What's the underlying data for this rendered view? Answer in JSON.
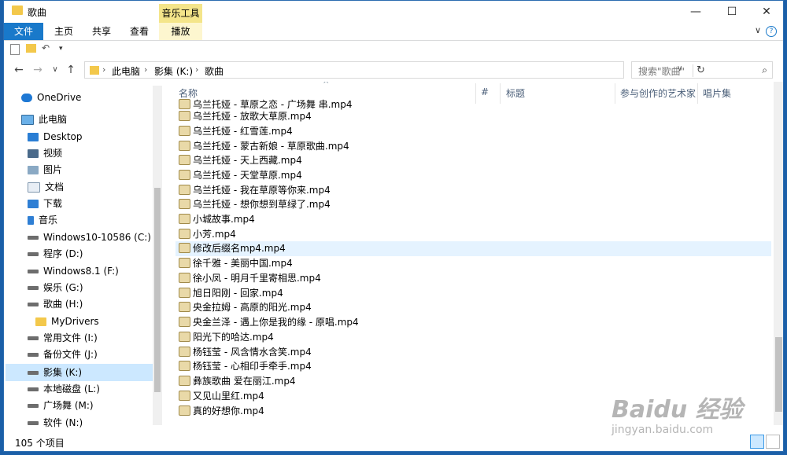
{
  "window": {
    "title": "歌曲",
    "music_tools": "音乐工具",
    "min": "—",
    "max": "☐",
    "close": "✕"
  },
  "ribbon": {
    "tabs": [
      "文件",
      "主页",
      "共享",
      "查看",
      "播放"
    ],
    "help": "?",
    "expand": "∨"
  },
  "nav": {
    "back": "←",
    "forward": "→",
    "up": "↑"
  },
  "address": {
    "crumbs": [
      "此电脑",
      "影集 (K:)",
      "歌曲"
    ],
    "sep": "›",
    "refresh": "↻",
    "dropdown": "∨"
  },
  "search": {
    "placeholder": "搜索\"歌曲\"",
    "icon": "⌕"
  },
  "sidebar": {
    "items": [
      {
        "label": "OneDrive",
        "icon": "cloud-icon"
      },
      {
        "label": "此电脑",
        "icon": "computer-icon"
      },
      {
        "label": "Desktop",
        "icon": "desktop-icon"
      },
      {
        "label": "视频",
        "icon": "video-icon"
      },
      {
        "label": "图片",
        "icon": "pictures-icon"
      },
      {
        "label": "文档",
        "icon": "documents-icon"
      },
      {
        "label": "下载",
        "icon": "download-icon"
      },
      {
        "label": "音乐",
        "icon": "music-icon"
      },
      {
        "label": "Windows10-10586 (C:)",
        "icon": "drive-icon"
      },
      {
        "label": "程序 (D:)",
        "icon": "drive-icon"
      },
      {
        "label": "Windows8.1 (F:)",
        "icon": "drive-icon"
      },
      {
        "label": "娱乐 (G:)",
        "icon": "drive-icon"
      },
      {
        "label": "歌曲 (H:)",
        "icon": "drive-icon"
      },
      {
        "label": "MyDrivers",
        "icon": "folder-icon"
      },
      {
        "label": "常用文件 (I:)",
        "icon": "drive-icon"
      },
      {
        "label": "备份文件 (J:)",
        "icon": "drive-icon"
      },
      {
        "label": "影集 (K:)",
        "icon": "drive-icon"
      },
      {
        "label": "本地磁盘 (L:)",
        "icon": "drive-icon"
      },
      {
        "label": "广场舞 (M:)",
        "icon": "drive-icon"
      },
      {
        "label": "软件 (N:)",
        "icon": "drive-icon"
      }
    ]
  },
  "columns": [
    "名称",
    "#",
    "标题",
    "参与创作的艺术家",
    "唱片集"
  ],
  "files": [
    "乌兰托娅 - 草原之恋 - 广场舞 串.mp4",
    "乌兰托娅 - 放歌大草原.mp4",
    "乌兰托娅 - 红雪莲.mp4",
    "乌兰托娅 - 蒙古新娘 - 草原歌曲.mp4",
    "乌兰托娅 - 天上西藏.mp4",
    "乌兰托娅 - 天堂草原.mp4",
    "乌兰托娅 - 我在草原等你来.mp4",
    "乌兰托娅 - 想你想到草绿了.mp4",
    "小城故事.mp4",
    "小芳.mp4",
    "修改后缀名mp4.mp4",
    "徐千雅 - 美丽中国.mp4",
    "徐小凤 - 明月千里寄相思.mp4",
    "旭日阳刚 - 回家.mp4",
    "央金拉姆 - 高原的阳光.mp4",
    "央金兰泽 - 遇上你是我的缘 - 原唱.mp4",
    "阳光下的哈达.mp4",
    "杨钰莹 - 风含情水含笑.mp4",
    "杨钰莹 - 心相印手牵手.mp4",
    "彝族歌曲 爱在丽江.mp4",
    "又见山里红.mp4",
    "真的好想你.mp4"
  ],
  "status": {
    "count": "105 个项目"
  },
  "watermark": {
    "brand": "Baidu 经验",
    "url": "jingyan.baidu.com"
  }
}
